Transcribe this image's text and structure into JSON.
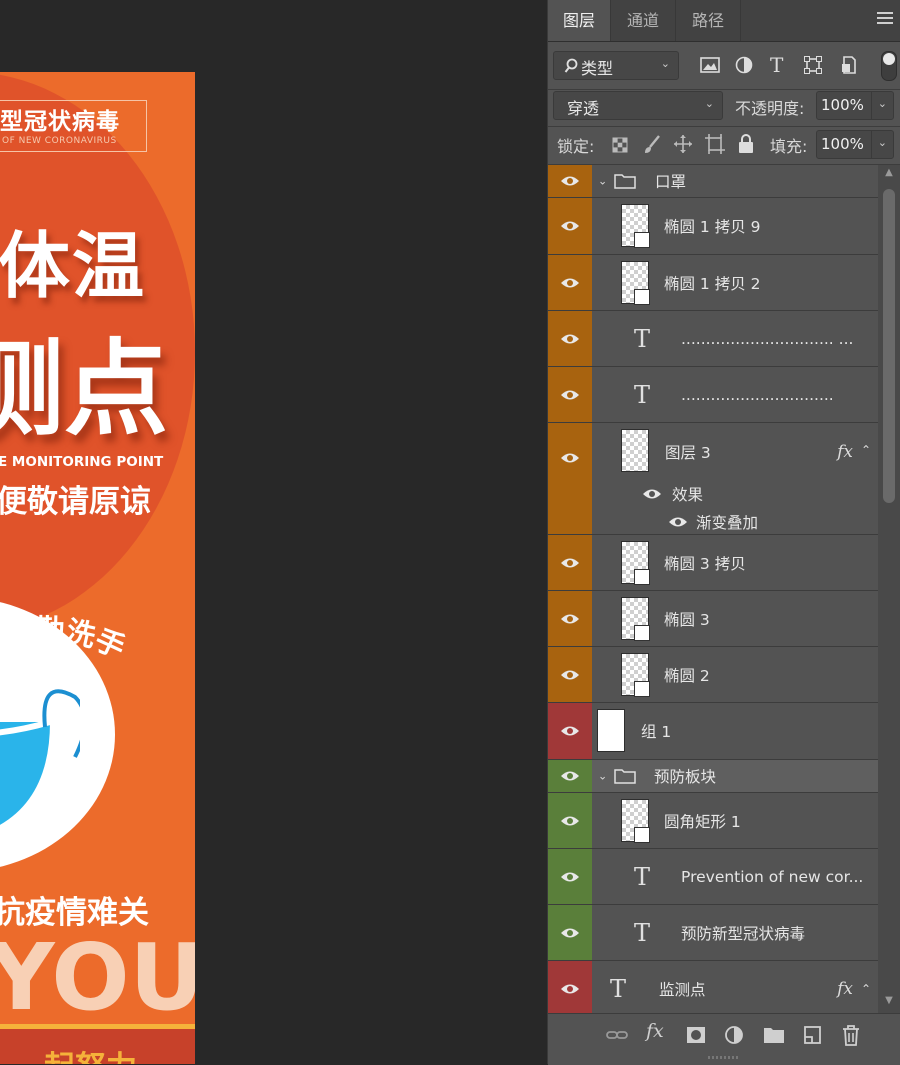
{
  "poster": {
    "badge_cn": "型冠状病毒",
    "badge_en": "OF NEW CORONAVIRUS",
    "big_line1": "体温",
    "big_line2": "测点",
    "en_line": "E MONITORING POINT",
    "cn_line": "便敬请原谅",
    "curve_text": "回家勤洗手",
    "cn_line2": "抗疫情难关",
    "you": "YOU",
    "bottom_text": "起努力",
    "colors": {
      "bg": "#ec6b2b",
      "accent": "#f5b23a",
      "white": "#ffffff"
    }
  },
  "panel": {
    "tabs": [
      {
        "label": "图层",
        "active": true
      },
      {
        "label": "通道",
        "active": false
      },
      {
        "label": "路径",
        "active": false
      }
    ],
    "filter": {
      "label": "类型",
      "icon": "search-icon"
    },
    "filter_icons": [
      "image-filter-icon",
      "adjustment-filter-icon",
      "type-filter-icon",
      "shape-filter-icon",
      "smart-object-filter-icon"
    ],
    "blend_mode": "穿透",
    "opacity_label": "不透明度:",
    "opacity_value": "100%",
    "lock_label": "锁定:",
    "fill_label": "填充:",
    "fill_value": "100%",
    "layers": [
      {
        "name": "口罩",
        "kind": "group",
        "color": "orange",
        "expanded": true
      },
      {
        "name": "椭圆 1 拷贝 9",
        "kind": "shape",
        "color": "orange"
      },
      {
        "name": "椭圆 1 拷贝 2",
        "kind": "shape",
        "color": "orange"
      },
      {
        "name": "............................... ...",
        "kind": "text",
        "color": "orange"
      },
      {
        "name": "...............................",
        "kind": "text",
        "color": "orange"
      },
      {
        "name": "图层 3",
        "kind": "pixel",
        "color": "orange",
        "fx": "fx",
        "effects_label": "效果",
        "effects": [
          "渐变叠加"
        ]
      },
      {
        "name": "椭圆 3 拷贝",
        "kind": "shape",
        "color": "orange"
      },
      {
        "name": "椭圆 3",
        "kind": "shape",
        "color": "orange"
      },
      {
        "name": "椭圆 2",
        "kind": "shape",
        "color": "orange"
      },
      {
        "name": "组 1",
        "kind": "pixel-white",
        "color": "red"
      },
      {
        "name": "预防板块",
        "kind": "group",
        "color": "green",
        "expanded": true
      },
      {
        "name": "圆角矩形 1",
        "kind": "shape",
        "color": "green"
      },
      {
        "name": "Prevention of new cor...",
        "kind": "text",
        "color": "green"
      },
      {
        "name": "预防新型冠状病毒",
        "kind": "text",
        "color": "green"
      },
      {
        "name": "监测点",
        "kind": "text",
        "color": "red",
        "fx": "fx"
      }
    ],
    "bottom_icons": [
      "link-layers-icon",
      "add-style-icon",
      "add-mask-icon",
      "adjustment-layer-icon",
      "new-group-icon",
      "new-layer-icon",
      "delete-layer-icon"
    ]
  }
}
